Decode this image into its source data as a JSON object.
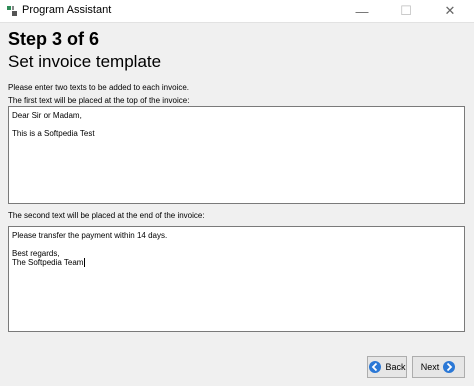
{
  "window": {
    "title": "Program Assistant",
    "app_icon": "wrench-gear-icon",
    "controls": {
      "minimize": "—",
      "maximize": "☐",
      "close": "✕"
    }
  },
  "header": {
    "step": "Step 3 of 6",
    "title": "Set invoice template"
  },
  "labels": {
    "intro": "Please enter two texts to be added to each invoice.",
    "first": "The first text will be placed at the top of the invoice:",
    "second": "The second text will be placed at the end of the invoice:"
  },
  "fields": {
    "first_text": "Dear Sir or Madam,\n\nThis is a Softpedia Test",
    "second_text": "Please transfer the payment within 14 days.\n\nBest regards,\nThe Softpedia Team"
  },
  "buttons": {
    "back": "Back",
    "next": "Next"
  },
  "colors": {
    "arrow_blue": "#2b78d6",
    "window_bg": "#f0f0f0"
  }
}
